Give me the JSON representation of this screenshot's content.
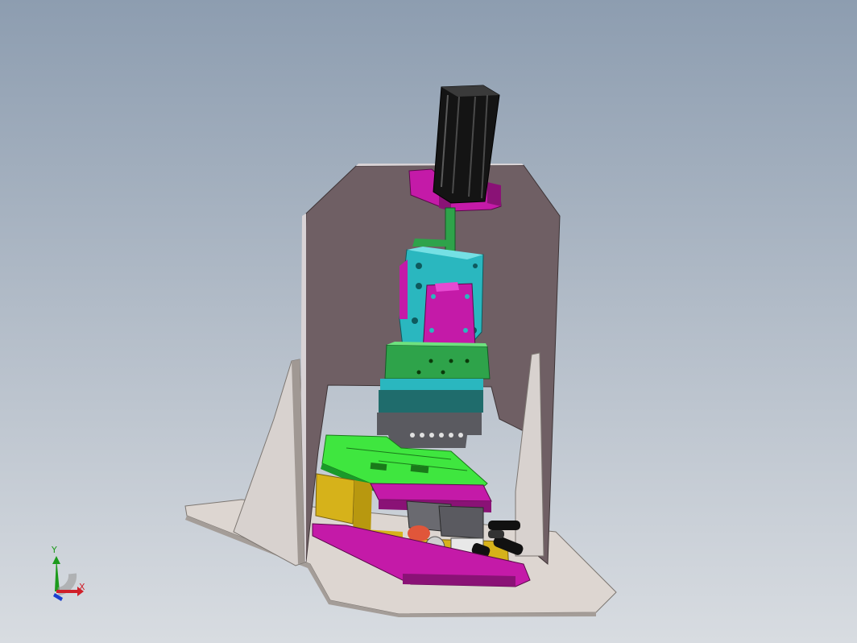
{
  "viewport": {
    "background_top": "#8d9db0",
    "background_bottom": "#d8dce1"
  },
  "model": {
    "description_colors": {
      "frame": "#6f5f64",
      "base": "#ddd6d1",
      "cylinder": "#111111",
      "magenta": "#c41aa8",
      "cyan": "#2ab7bf",
      "green": "#2ea34a",
      "lime": "#3fe63f",
      "yellow": "#d6b21a",
      "teal": "#1f6c6c",
      "gray": "#5a5a60"
    }
  },
  "triad": {
    "x_label": "X",
    "y_label": "Y"
  }
}
